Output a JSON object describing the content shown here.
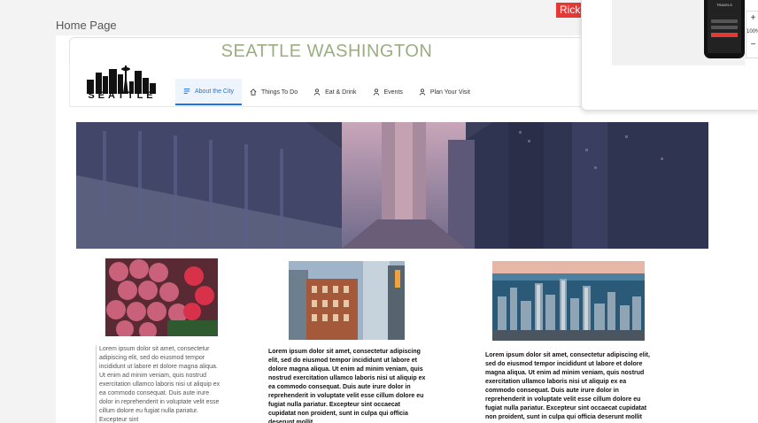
{
  "page": {
    "label": "Home Page"
  },
  "header": {
    "title": "SEATTLE WASHINGTON",
    "logo_text": "SEATTLE"
  },
  "nav": {
    "items": [
      {
        "label": "About the City",
        "icon": "list-icon",
        "active": true
      },
      {
        "label": "Things To Do",
        "icon": "home-icon",
        "active": false
      },
      {
        "label": "Eat & Drink",
        "icon": "person-icon",
        "active": false
      },
      {
        "label": "Events",
        "icon": "person-icon",
        "active": false
      },
      {
        "label": "Plan Your Visit",
        "icon": "person-icon",
        "active": false
      }
    ]
  },
  "topbar": {
    "user": "Rick"
  },
  "flyout": {
    "phone_text": "TRAVELS",
    "zoom": "100%",
    "plus": "+",
    "minus": "−"
  },
  "cards": [
    {
      "text": "Lorem ipsum dolor sit amet, consectetur adipiscing elit, sed do eiusmod tempor incididunt ut labore et dolore magna aliqua. Ut enim ad minim veniam, quis nostrud exercitation ullamco laboris nisi ut aliquip ex ea commodo consequat. Duis aute irure dolor in reprehenderit in voluptate velit esse cillum dolore eu fugiat nulla pariatur. Excepteur sint"
    },
    {
      "text": "Lorem ipsum dolor sit amet, consectetur adipiscing elit, sed do eiusmod tempor incididunt ut labore et dolore magna aliqua. Ut enim ad minim veniam, quis nostrud exercitation ullamco laboris nisi ut aliquip ex ea commodo consequat. Duis aute irure dolor in reprehenderit in voluptate velit esse cillum dolore eu fugiat nulla pariatur. Excepteur sint occaecat cupidatat non proident, sunt in culpa qui officia deserunt mollit"
    },
    {
      "text": "Lorem ipsum dolor sit amet, consectetur adipiscing elit, sed do eiusmod tempor incididunt ut labore et dolore magna aliqua. Ut enim ad minim veniam, quis nostrud exercitation ullamco laboris nisi ut aliquip ex ea commodo consequat. Duis aute irure dolor in reprehenderit in voluptate velit esse cillum dolore eu fugiat nulla pariatur. Excepteur sint occaecat cupidatat non proident, sunt in culpa qui officia deserunt mollit"
    }
  ],
  "colors": {
    "title": "#9aae82",
    "accent": "#1a73e8",
    "badge": "#e53935"
  }
}
